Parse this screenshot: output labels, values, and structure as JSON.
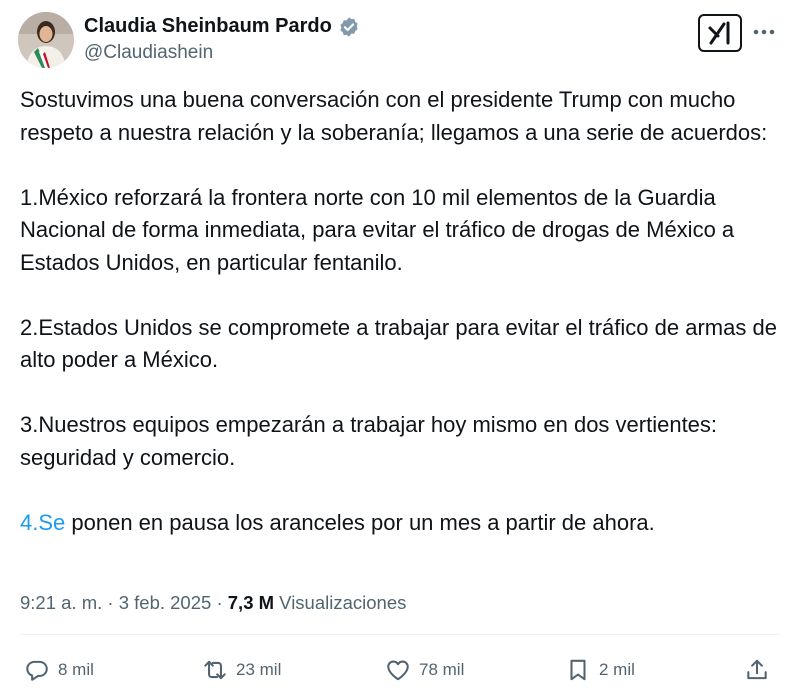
{
  "author": {
    "display_name": "Claudia Sheinbaum Pardo",
    "handle": "@Claudiashein",
    "avatar_icon": "avatar-photo"
  },
  "header": {
    "grok_icon": "grok-icon",
    "more_icon": "more-icon"
  },
  "tweet": {
    "intro": "Sostuvimos una buena conversación con el presidente Trump con mucho respeto a nuestra relación y la soberanía; llegamos a una serie de acuerdos:",
    "point1": "1.México reforzará la frontera norte con 10 mil elementos de la Guardia Nacional de forma inmediata, para evitar el tráfico de drogas de México a Estados Unidos, en particular fentanilo.",
    "point2": "2.Estados Unidos se compromete a trabajar para evitar el tráfico de armas de alto poder a México.",
    "point3": "3.Nuestros equipos empezarán a trabajar hoy mismo en dos vertientes: seguridad y comercio.",
    "point4_link": "4.Se",
    "point4_rest": " ponen en pausa los aranceles por un mes a partir de ahora.",
    "link_color": "#1d9bf0"
  },
  "meta": {
    "time": "9:21 a. m.",
    "sep1": " · ",
    "date": "3 feb. 2025",
    "sep2": " · ",
    "views_count": "7,3 M",
    "views_label": " Visualizaciones"
  },
  "actions": {
    "replies": "8 mil",
    "reposts": "23 mil",
    "likes": "78 mil",
    "bookmarks": "2 mil"
  },
  "colors": {
    "text": "#0f1419",
    "secondary": "#536471",
    "accent": "#1d9bf0",
    "divider": "#eff3f4"
  }
}
